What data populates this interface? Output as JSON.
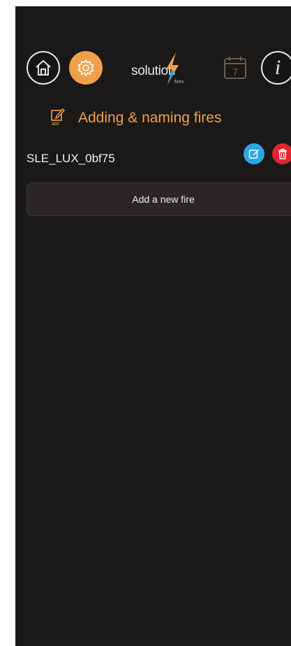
{
  "nav": {
    "home_icon": "home-icon",
    "settings_icon": "gear-icon",
    "calendar_icon": "calendar-icon",
    "calendar_day": "7",
    "info_icon": "info-icon",
    "info_glyph": "i"
  },
  "logo": {
    "text": "solution",
    "subtext": "fires"
  },
  "section": {
    "icon": "edit-abc-icon",
    "icon_caption": "abc",
    "title": "Adding & naming fires"
  },
  "fires": [
    {
      "name": "SLE_LUX_0bf75",
      "edit_icon": "edit-icon",
      "delete_icon": "trash-icon"
    }
  ],
  "add_fire": {
    "label": "Add a new fire"
  },
  "colors": {
    "background": "#1b1818",
    "accent": "#f0a04b",
    "edit": "#2aa8e6",
    "delete": "#e2262e"
  }
}
